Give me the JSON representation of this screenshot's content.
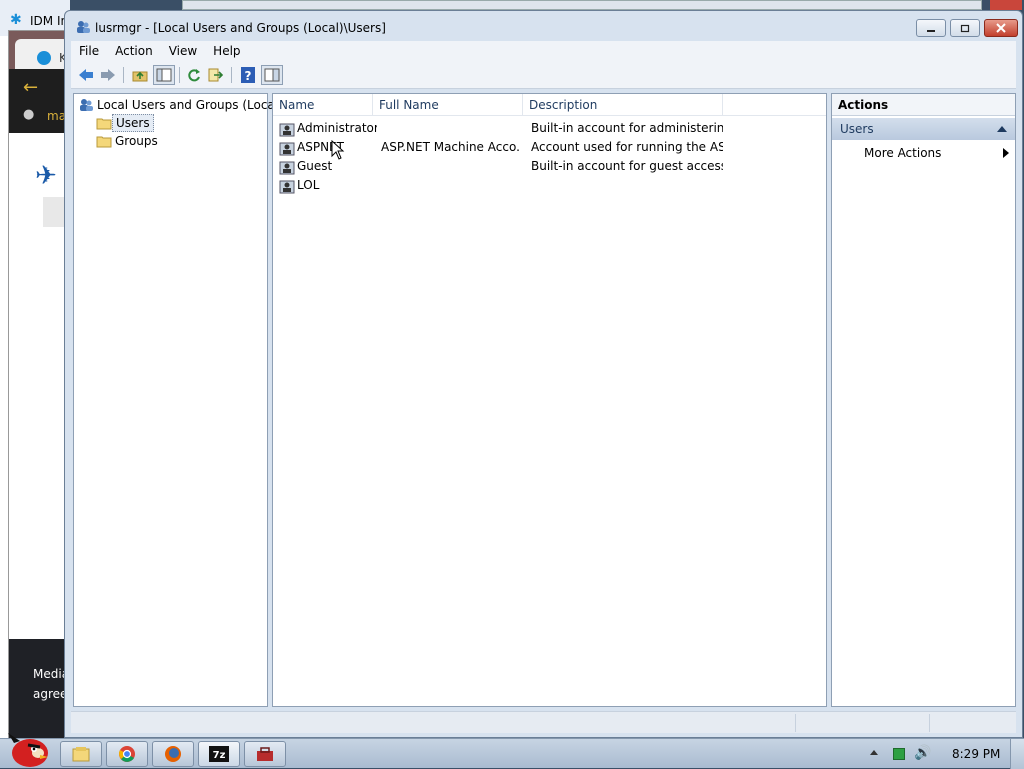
{
  "background": {
    "idm_text": "IDM In",
    "tab_text": "Ko",
    "address_text": "mai",
    "footer_line1": "Media",
    "footer_line2": "agree"
  },
  "window": {
    "title": "lusrmgr - [Local Users and Groups (Local)\\Users]"
  },
  "menu": [
    "File",
    "Action",
    "View",
    "Help"
  ],
  "tree": {
    "root": "Local Users and Groups (Local)",
    "children": [
      {
        "label": "Users",
        "selected": true
      },
      {
        "label": "Groups",
        "selected": false
      }
    ]
  },
  "list": {
    "columns": [
      "Name",
      "Full Name",
      "Description"
    ],
    "rows": [
      {
        "name": "Administrator",
        "full_name": "",
        "description": "Built-in account for administering..."
      },
      {
        "name": "ASPNET",
        "full_name": "ASP.NET Machine Acco...",
        "description": "Account used for running the AS..."
      },
      {
        "name": "Guest",
        "full_name": "",
        "description": "Built-in account for guest access t..."
      },
      {
        "name": "LOL",
        "full_name": "",
        "description": ""
      }
    ]
  },
  "actions": {
    "header": "Actions",
    "section": "Users",
    "items": [
      "More Actions"
    ]
  },
  "taskbar": {
    "clock": "8:29 PM"
  },
  "colors": {
    "accent": "#1e3a5f",
    "close_red": "#c2402d"
  }
}
